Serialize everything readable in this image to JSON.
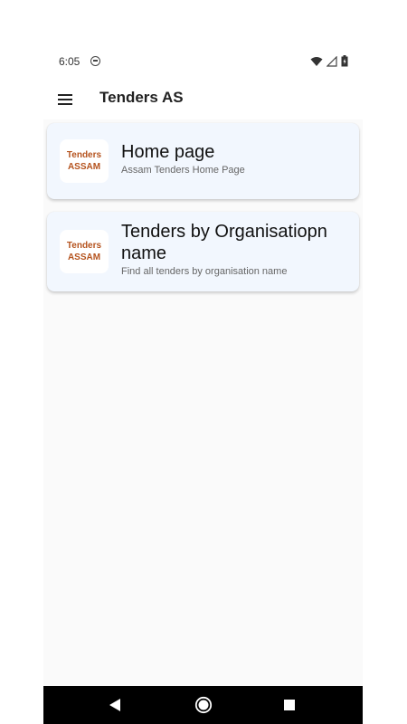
{
  "status_bar": {
    "time": "6:05"
  },
  "app_bar": {
    "title": "Tenders AS"
  },
  "cards": [
    {
      "logo_line1": "Tenders",
      "logo_line2": "ASSAM",
      "title": "Home page",
      "subtitle": "Assam Tenders Home Page"
    },
    {
      "logo_line1": "Tenders",
      "logo_line2": "ASSAM",
      "title": "Tenders by Organisatiopn name",
      "subtitle": "Find all tenders by organisation name"
    }
  ],
  "icons": {
    "status_app": "notification-icon",
    "wifi": "wifi-icon",
    "signal": "signal-icon",
    "battery": "battery-icon",
    "menu": "menu-icon",
    "back": "back-icon",
    "home": "home-icon",
    "recents": "recents-icon"
  },
  "colors": {
    "card_background": "#f2f7fe",
    "logo_text": "#b5531e",
    "nav_bar": "#000000"
  }
}
